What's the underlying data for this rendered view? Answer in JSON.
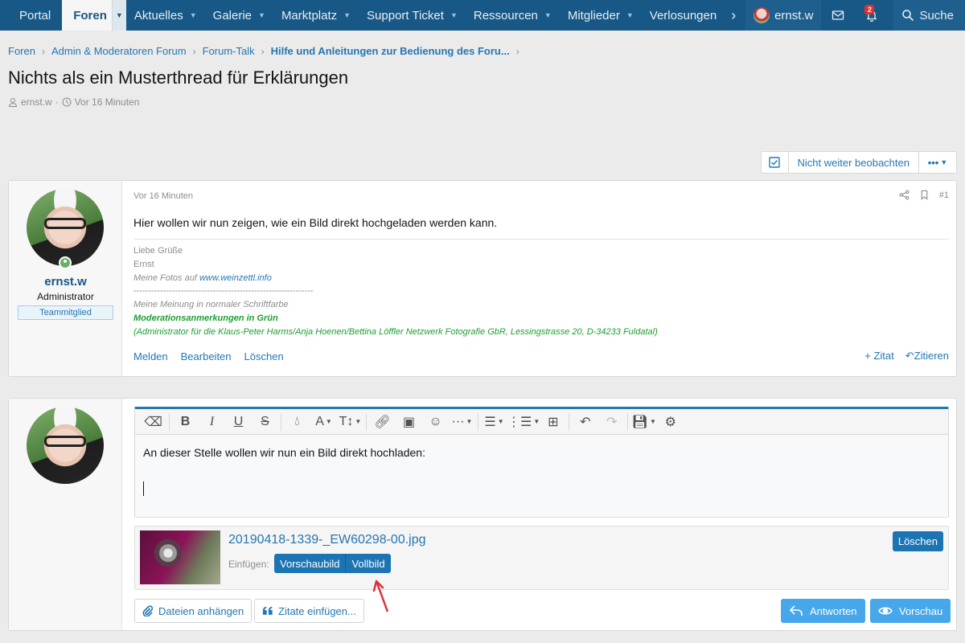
{
  "nav": {
    "items": [
      {
        "label": "Portal",
        "caret": false
      },
      {
        "label": "Foren",
        "caret": true,
        "active": true
      },
      {
        "label": "Aktuelles",
        "caret": true
      },
      {
        "label": "Galerie",
        "caret": true
      },
      {
        "label": "Marktplatz",
        "caret": true
      },
      {
        "label": "Support Ticket",
        "caret": true
      },
      {
        "label": "Ressourcen",
        "caret": true
      },
      {
        "label": "Mitglieder",
        "caret": true
      },
      {
        "label": "Verlosungen",
        "caret": false
      }
    ],
    "user": "ernst.w",
    "alerts_badge": "2",
    "search_label": "Suche"
  },
  "breadcrumb": [
    "Foren",
    "Admin & Moderatoren Forum",
    "Forum-Talk",
    "Hilfe und Anleitungen zur Bedienung des Foru..."
  ],
  "thread": {
    "title": "Nichts als ein Musterthread für Erklärungen",
    "author": "ernst.w",
    "time": "Vor 16 Minuten"
  },
  "watch": {
    "label": "Nicht weiter beobachten",
    "more": "•••"
  },
  "post": {
    "username": "ernst.w",
    "user_title": "Administrator",
    "banner": "Teammitglied",
    "date": "Vor 16 Minuten",
    "number": "#1",
    "body": "Hier wollen wir nun zeigen, wie ein Bild direkt hochgeladen werden kann.",
    "signature": {
      "line1": "Liebe Grüße",
      "line2": "Ernst",
      "photos_prefix": "Meine Fotos auf ",
      "photos_link": "www.weinzettl.info",
      "divider": "-------------------------------------------------------------",
      "opinion": "Meine Meinung in normaler Schriftfarbe",
      "mod_note": "Moderationsanmerkungen in Grün",
      "admin_note": "(Administrator für die Klaus-Peter Harms/Anja Hoenen/Bettina Löffler Netzwerk Fotografie GbR, Lessingstrasse 20, D-34233 Fuldatal)"
    },
    "actions": {
      "report": "Melden",
      "edit": "Bearbeiten",
      "delete": "Löschen",
      "plus_quote": "+ Zitat",
      "reply_quote": "Zitieren"
    }
  },
  "editor": {
    "text": "An dieser Stelle wollen wir nun ein Bild direkt hochladen:"
  },
  "attachment": {
    "filename": "20190418-1339-_EW60298-00.jpg",
    "insert_label": "Einfügen:",
    "thumbnail_btn": "Vorschaubild",
    "full_btn": "Vollbild",
    "delete_btn": "Löschen"
  },
  "buttons": {
    "attach_files": "Dateien anhängen",
    "insert_quotes": "Zitate einfügen...",
    "reply": "Antworten",
    "preview": "Vorschau"
  },
  "colors": {
    "nav_bg": "#185886",
    "link": "#2577b1",
    "primary_btn": "#47a7eb",
    "mod_green": "#1e9e33"
  }
}
